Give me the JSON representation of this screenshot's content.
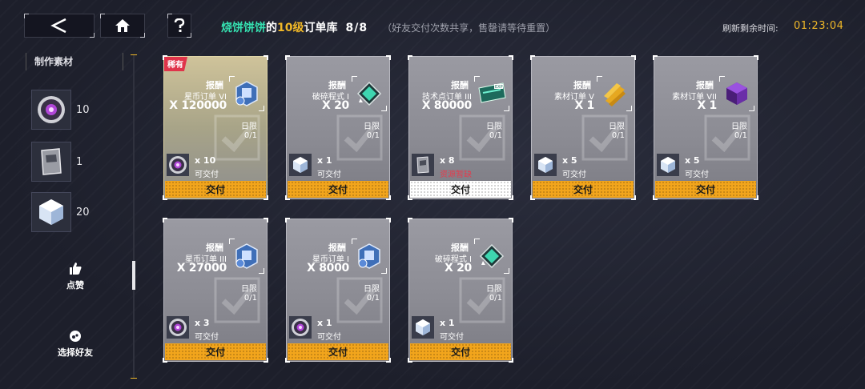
{
  "header": {
    "player_name": "烧饼饼饼",
    "possessive": "的",
    "level_text": "10级",
    "library_text": "订单库",
    "count": "8/8",
    "note": "（好友交付次数共享，售罄请等待重置）",
    "refresh_label": "刷新剩余时间:",
    "refresh_time": "01:23:04"
  },
  "sidebar": {
    "title": "制作素材",
    "materials": [
      {
        "icon": "purple-orb-icon",
        "count": "10"
      },
      {
        "icon": "exp-chip-icon",
        "count": "1"
      },
      {
        "icon": "crystal-cube-icon",
        "count": "20"
      }
    ],
    "like_label": "点赞",
    "select_friend_label": "选择好友"
  },
  "cards": [
    {
      "rare": true,
      "rare_label": "稀有",
      "reward_label": "报酬",
      "reward_name": "星币订单 VI",
      "reward_amount": "X 120000",
      "reward_icon": "star-coin-icon",
      "limit_label": "日限",
      "limit_value": "0/1",
      "req_icon": "purple-orb-icon",
      "req_qty": "x 10",
      "status": "可交付",
      "status_warn": false,
      "button": "交付",
      "disabled": false
    },
    {
      "rare": false,
      "reward_label": "报酬",
      "reward_name": "破碎程式 I",
      "reward_amount": "X 20",
      "reward_icon": "shard-icon",
      "limit_label": "日限",
      "limit_value": "0/1",
      "req_icon": "crystal-cube-icon",
      "req_qty": "x 1",
      "status": "可交付",
      "status_warn": false,
      "button": "交付",
      "disabled": false
    },
    {
      "rare": false,
      "reward_label": "报酬",
      "reward_name": "技术点订单 III",
      "reward_amount": "X 80000",
      "reward_icon": "exp-chip-icon",
      "limit_label": "日限",
      "limit_value": "0/1",
      "req_icon": "exp-chip-icon",
      "req_qty": "x 8",
      "status": "资源暂缺",
      "status_warn": true,
      "button": "交付",
      "disabled": true
    },
    {
      "rare": false,
      "reward_label": "报酬",
      "reward_name": "素材订单 V",
      "reward_amount": "X 1",
      "reward_icon": "gold-bars-icon",
      "limit_label": "日限",
      "limit_value": "0/1",
      "req_icon": "crystal-cube-icon",
      "req_qty": "x 5",
      "status": "可交付",
      "status_warn": false,
      "button": "交付",
      "disabled": false
    },
    {
      "rare": false,
      "reward_label": "报酬",
      "reward_name": "素材订单 VII",
      "reward_amount": "X 1",
      "reward_icon": "purple-cube-icon",
      "limit_label": "日限",
      "limit_value": "0/1",
      "req_icon": "crystal-cube-icon",
      "req_qty": "x 5",
      "status": "可交付",
      "status_warn": false,
      "button": "交付",
      "disabled": false
    },
    {
      "rare": false,
      "reward_label": "报酬",
      "reward_name": "星币订单 III",
      "reward_amount": "X 27000",
      "reward_icon": "star-coin-icon",
      "limit_label": "日限",
      "limit_value": "0/1",
      "req_icon": "purple-orb-icon",
      "req_qty": "x 3",
      "status": "可交付",
      "status_warn": false,
      "button": "交付",
      "disabled": false
    },
    {
      "rare": false,
      "reward_label": "报酬",
      "reward_name": "星币订单 I",
      "reward_amount": "X 8000",
      "reward_icon": "star-coin-icon",
      "limit_label": "日限",
      "limit_value": "0/1",
      "req_icon": "purple-orb-icon",
      "req_qty": "x 1",
      "status": "可交付",
      "status_warn": false,
      "button": "交付",
      "disabled": false
    },
    {
      "rare": false,
      "reward_label": "报酬",
      "reward_name": "破碎程式 I",
      "reward_amount": "X 20",
      "reward_icon": "shard-icon",
      "limit_label": "日限",
      "limit_value": "0/1",
      "req_icon": "crystal-cube-icon",
      "req_qty": "x 1",
      "status": "可交付",
      "status_warn": false,
      "button": "交付",
      "disabled": false
    }
  ]
}
